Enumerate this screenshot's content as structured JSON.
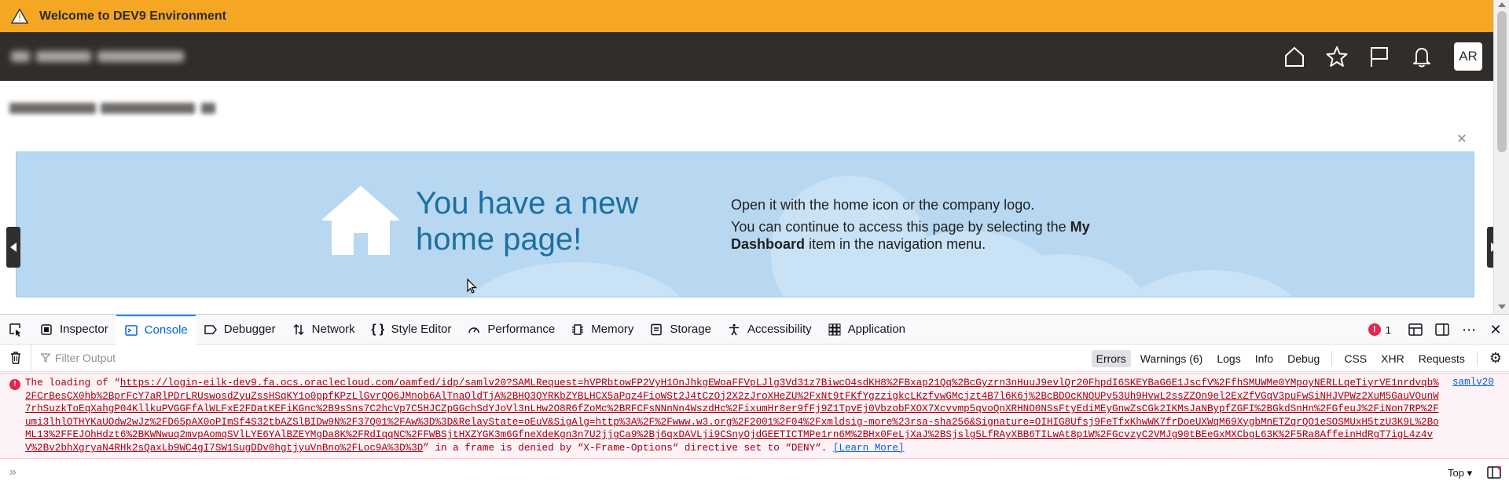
{
  "banner": {
    "icon": "warning-icon",
    "text": "Welcome to DEV9 Environment",
    "color": "#f5a623"
  },
  "header": {
    "background": "#312d2a",
    "icons": [
      "home-icon",
      "star-icon",
      "flag-icon",
      "bell-icon"
    ],
    "avatar_initials": "AR"
  },
  "hero": {
    "title": "You have a new home page!",
    "line1": "Open it with the home icon or the company logo.",
    "line2_pre": "You can continue to access this page by selecting the ",
    "line2_bold": "My Dashboard",
    "line2_post": " item in the navigation menu.",
    "background": "#b8d8f1",
    "title_color": "#1d6fa0"
  },
  "devtools": {
    "tabs": [
      {
        "label": "Inspector",
        "icon": "inspector-icon"
      },
      {
        "label": "Console",
        "icon": "console-icon",
        "active": true
      },
      {
        "label": "Debugger",
        "icon": "debugger-icon"
      },
      {
        "label": "Network",
        "icon": "network-icon"
      },
      {
        "label": "Style Editor",
        "icon": "style-editor-icon"
      },
      {
        "label": "Performance",
        "icon": "performance-icon"
      },
      {
        "label": "Memory",
        "icon": "memory-icon"
      },
      {
        "label": "Storage",
        "icon": "storage-icon"
      },
      {
        "label": "Accessibility",
        "icon": "accessibility-icon"
      },
      {
        "label": "Application",
        "icon": "application-icon"
      }
    ],
    "error_count": "1",
    "filter_placeholder": "Filter Output",
    "filter_buttons": {
      "errors": "Errors",
      "warnings": "Warnings (6)",
      "logs": "Logs",
      "info": "Info",
      "debug": "Debug",
      "css": "CSS",
      "xhr": "XHR",
      "requests": "Requests"
    },
    "message": {
      "prefix": "The loading of “",
      "url": "https://login-eilk-dev9.fa.ocs.oraclecloud.com/oamfed/idp/samlv20?SAMLRequest=hVPRbtowFP2VyH1OnJhkgEWoaFFVpLJlg3Vd31z7BiwcO4sdKH8%2FBxap21Qq%2BcGyzrn3nHuuJ9evlQr20FhpdI6SKEYBaG6E1JscfV%2FfhSMUWMe0YMpoyNERLLqeTiyrVE1nrdvqb%2FCrBesCX0hb%2BprFcY7aRlPDrLRUswosdZyuZssHSqKY1o0ppfKPzLlGvrQO6JMnob6AlTnaOldTjA%2BHQ3QYRKbZYBLHCX5aPqz4FioWSt2J4tCzOj2X2zJroXHeZU%2FxNt9tFKfYgzzigkcLKzfvwGMcjzt4B7l6K6j%2BcBDOcKNQUPy53Uh9HvwL2ssZZOn9el2ExZfVGqV3puFwSiNHJVPWz2XuM5GauVOunW7rhSuzkToEqXahgP04KllkuPVGGFfAlWLFxE2FDatKEFiKGnc%2B9sSns7C2hcVp7C5HJCZpGGchSdYJoVl3nLHw2O8R6fZoMc%2BRFCFsNNnNn4WszdHc%2FixumHr8er9fFj9Z1TpvEj0VbzobFXOX7Xcvvmp5qvoQnXRHNO0NSsFtyEdiMEyGnwZsCGk2IKMsJaNBypfZGFI%2BGkdSnHn%2FGfeuJ%2FiNon7RP%2Fumi3lhlOTHYKaUOdw2wJz%2FD65pAX0oPImSf4S32tbAZSlBIDw9N%2F37Q01%2FAw%3D%3D&RelayState=oEuV&SigAlg=http%3A%2F%2Fwww.w3.org%2F2001%2F04%2Fxmldsig-more%23rsa-sha256&Signature=OIHIG8Ufsj9FeTfxKhwWK7frDoeUXWqM69XygbMnETZqrQO1eSOSMUxH5tzU3K9L%2BoML13%2FFEJOhHdzt6%2BKWNwuq2mvpAomqSVlLYE6YAlBZEYMgDa8K%2FRdIqqNC%2FFWBSjtHXZYGK3m6GfneXdeKgn3n7U2jjgCa9%2Bj6qxDAVLji9CSnyOjdGEETICTMPe1rn6M%2BHx0FeLjXaJ%2BSjslg5LfRAyXBB6TILwAt8p1W%2FGcvzyC2VMJg90tBEeGxMXCbgL63K%2F5Ra8AffeinHdRgT7igL4z4vV%2Bv2bhXgryaN4RHk2sQaxLb9WC4gI7SW1SugDDv0hgtjyuVnBno%2FLoc9A%3D%3D",
      "suffix": "” in a frame is denied by “X-Frame-Options“ directive set to “DENY“. ",
      "learn_more": "[Learn More]",
      "source": "samlv20"
    },
    "context_selector": "Top"
  }
}
